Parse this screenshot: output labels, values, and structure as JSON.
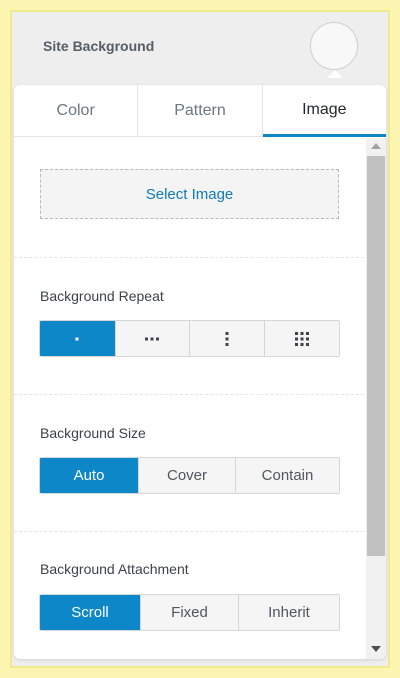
{
  "header": {
    "title": "Site Background",
    "swatch_color": "#f8f8f8"
  },
  "tabs": [
    {
      "label": "Color",
      "active": false
    },
    {
      "label": "Pattern",
      "active": false
    },
    {
      "label": "Image",
      "active": true
    }
  ],
  "image_tab": {
    "select_image_label": "Select Image",
    "background_repeat": {
      "label": "Background Repeat",
      "options": [
        {
          "icon": "no-repeat-icon",
          "active": true
        },
        {
          "icon": "repeat-x-icon",
          "active": false
        },
        {
          "icon": "repeat-y-icon",
          "active": false
        },
        {
          "icon": "repeat-all-icon",
          "active": false
        }
      ]
    },
    "background_size": {
      "label": "Background Size",
      "options": [
        {
          "label": "Auto",
          "active": true
        },
        {
          "label": "Cover",
          "active": false
        },
        {
          "label": "Contain",
          "active": false
        }
      ]
    },
    "background_attachment": {
      "label": "Background Attachment",
      "options": [
        {
          "label": "Scroll",
          "active": true
        },
        {
          "label": "Fixed",
          "active": false
        },
        {
          "label": "Inherit",
          "active": false
        }
      ]
    }
  },
  "colors": {
    "accent": "#0e87c9",
    "link": "#0e7cb4"
  }
}
